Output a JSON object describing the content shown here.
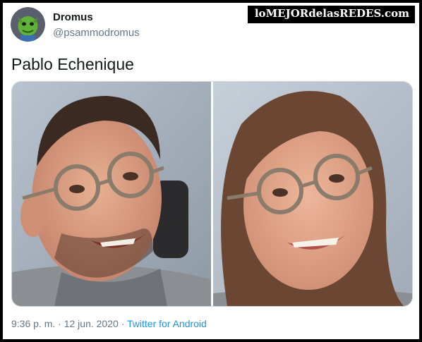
{
  "user": {
    "display_name": "Dromus",
    "handle": "@psammodromus"
  },
  "watermark": "loMEJORdelasREDES.com",
  "tweet": {
    "text": "Pablo Echenique"
  },
  "footer": {
    "time": "9:36 p. m.",
    "separator": "·",
    "date": "12 jun. 2020",
    "source": "Twitter for Android"
  },
  "colors": {
    "link": "#1b95e0",
    "muted": "#657786",
    "text": "#14171a"
  }
}
